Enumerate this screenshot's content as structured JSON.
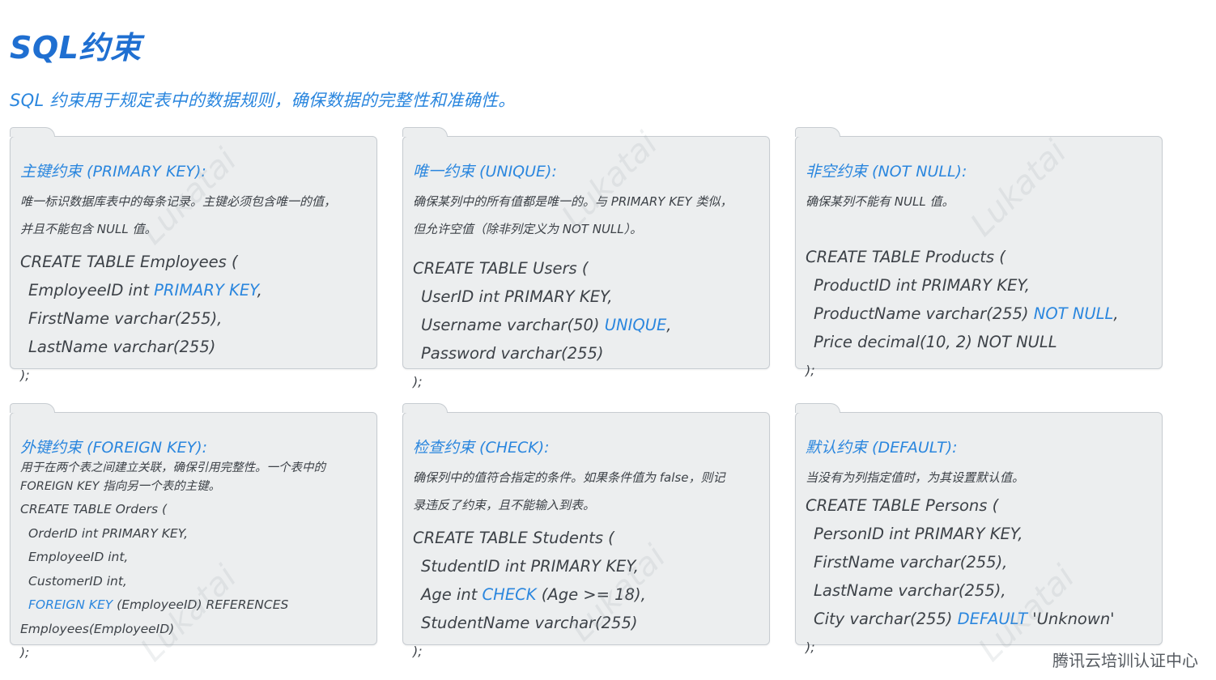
{
  "title": "SQL约束",
  "subtitle": "SQL 约束用于规定表中的数据规则，确保数据的完整性和准确性。",
  "cards": [
    {
      "title": "主键约束 (PRIMARY KEY):",
      "desc": [
        "唯一标识数据库表中的每条记录。主键必须包含唯一的值，",
        "并且不能包含 NULL 值。"
      ],
      "code": [
        "CREATE TABLE Employees (",
        "EmployeeID int ",
        "PRIMARY KEY",
        ",",
        "FirstName varchar(255),",
        "LastName varchar(255)",
        ");"
      ]
    },
    {
      "title": "唯一约束 (UNIQUE):",
      "desc": [
        "确保某列中的所有值都是唯一的。与 PRIMARY KEY 类似，",
        "但允许空值（除非列定义为 NOT NULL）。"
      ],
      "code": [
        "CREATE TABLE Users (",
        "UserID int PRIMARY KEY,",
        "Username varchar(50) ",
        "UNIQUE",
        ",",
        "Password varchar(255)",
        ");"
      ]
    },
    {
      "title": "非空约束 (NOT NULL):",
      "desc": [
        "确保某列不能有 NULL 值。"
      ],
      "code": [
        "CREATE TABLE Products (",
        "ProductID int PRIMARY KEY,",
        "ProductName varchar(255) ",
        "NOT NULL",
        ",",
        "Price decimal(10, 2) NOT NULL",
        ");"
      ]
    },
    {
      "title": "外键约束 (FOREIGN KEY):",
      "desc": [
        "用于在两个表之间建立关联，确保引用完整性。一个表中的",
        "FOREIGN KEY 指向另一个表的主键。"
      ],
      "code": [
        "CREATE TABLE Orders (",
        "OrderID int PRIMARY KEY,",
        "EmployeeID int,",
        "CustomerID int,",
        "FOREIGN KEY",
        " (EmployeeID) REFERENCES",
        "Employees(EmployeeID)",
        ");"
      ]
    },
    {
      "title": "检查约束 (CHECK):",
      "desc": [
        "确保列中的值符合指定的条件。如果条件值为 false，则记",
        "录违反了约束，且不能输入到表。"
      ],
      "code": [
        "CREATE TABLE Students (",
        "StudentID int PRIMARY KEY,",
        "Age int ",
        "CHECK",
        " (Age >= 18),",
        "StudentName varchar(255)",
        ");"
      ]
    },
    {
      "title": "默认约束 (DEFAULT):",
      "desc": [
        "当没有为列指定值时，为其设置默认值。"
      ],
      "code": [
        "CREATE TABLE Persons (",
        "PersonID int PRIMARY KEY,",
        "FirstName varchar(255),",
        "LastName varchar(255),",
        "City varchar(255) ",
        "DEFAULT",
        " 'Unknown'",
        ");"
      ]
    }
  ],
  "watermark": "Lukatai",
  "footer": "腾讯云培训认证中心",
  "colors": {
    "accent": "#2a86de",
    "title": "#1f6fd1",
    "card_bg": "#eceeef",
    "card_border": "#c7ccd1"
  }
}
